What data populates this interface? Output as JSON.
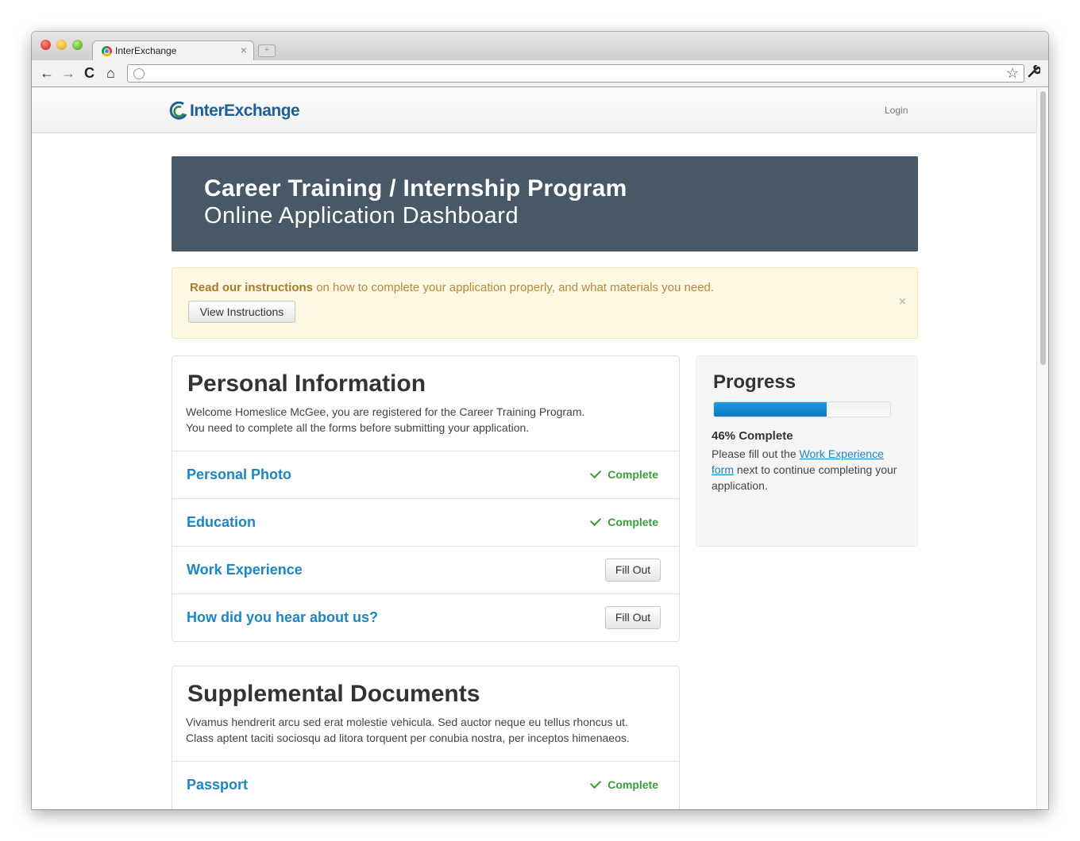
{
  "browser": {
    "tab_title": "InterExchange",
    "tab_close": "×",
    "new_tab": "+",
    "back": "←",
    "forward": "→",
    "reload": "C",
    "home": "⌂",
    "star": "☆",
    "wrench": "🔧",
    "address": ""
  },
  "site": {
    "logo_text": "InterExchange",
    "login_label": "Login"
  },
  "hero": {
    "title": "Career Training / Internship Program",
    "subtitle": "Online Application Dashboard"
  },
  "alert": {
    "strong": "Read our instructions",
    "text": " on how to complete your application properly, and what materials you need.",
    "button_label": "View Instructions",
    "close": "×"
  },
  "personal": {
    "title": "Personal Information",
    "desc_line1": "Welcome Homeslice McGee, you are registered for the Career Training Program.",
    "desc_line2": "You need to complete all the forms before submitting your application.",
    "rows": [
      {
        "label": "Personal Photo",
        "status": "Complete"
      },
      {
        "label": "Education",
        "status": "Complete"
      },
      {
        "label": "Work Experience",
        "action": "Fill Out"
      },
      {
        "label": "How did you hear about us?",
        "action": "Fill Out"
      }
    ]
  },
  "supplemental": {
    "title": "Supplemental Documents",
    "desc_line1": "Vivamus hendrerit arcu sed erat molestie vehicula. Sed auctor neque eu tellus rhoncus ut.",
    "desc_line2": "Class aptent taciti sociosqu ad litora torquent per conubia nostra, per inceptos himenaeos.",
    "rows": [
      {
        "label": "Passport",
        "status": "Complete"
      }
    ]
  },
  "progress": {
    "title": "Progress",
    "percent": 64,
    "percent_label": "46% Complete",
    "note_prefix": "Please fill out the ",
    "note_link": "Work Experience form",
    "note_suffix": " next to continue completing your application.",
    "bar_color": "#0a78c0"
  }
}
